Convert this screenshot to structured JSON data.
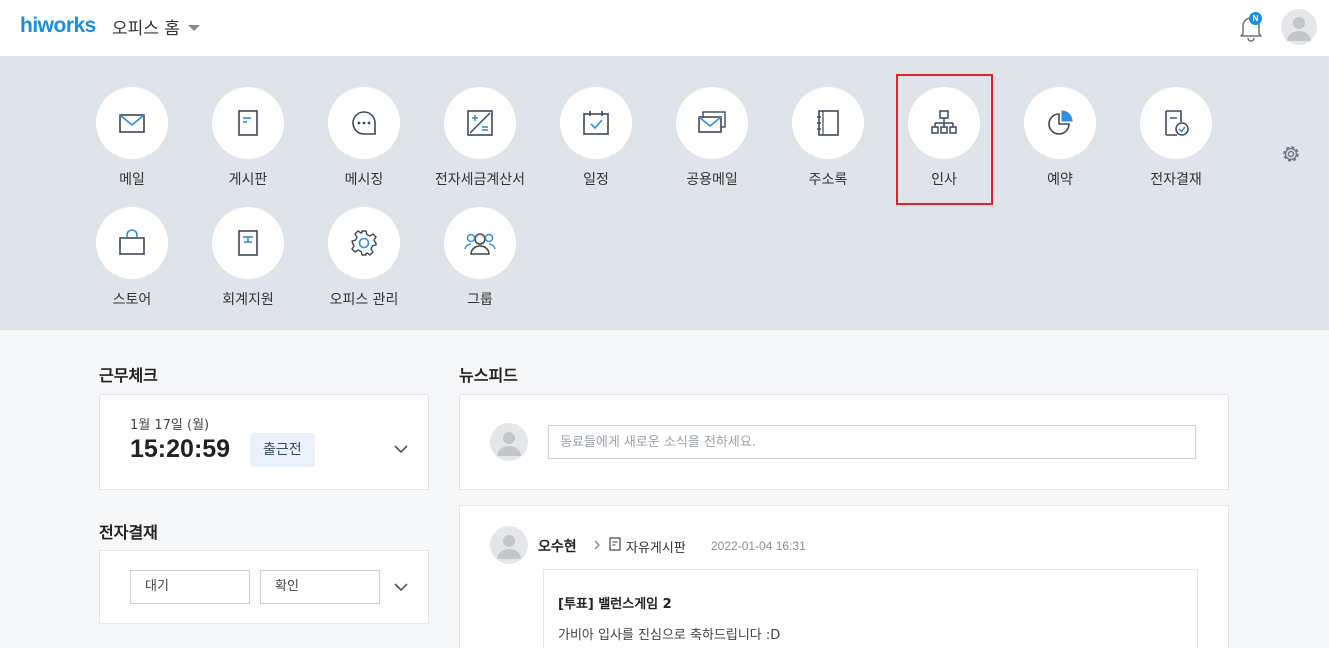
{
  "header": {
    "logo": "hiworks",
    "office_title": "오피스 홈",
    "notification_badge": "N"
  },
  "apps": [
    {
      "label": "메일",
      "icon": "mail-icon"
    },
    {
      "label": "게시판",
      "icon": "board-icon"
    },
    {
      "label": "메시징",
      "icon": "chat-bubble-icon"
    },
    {
      "label": "전자세금계산서",
      "icon": "tax-invoice-icon"
    },
    {
      "label": "일정",
      "icon": "calendar-icon"
    },
    {
      "label": "공용메일",
      "icon": "shared-mail-icon"
    },
    {
      "label": "주소록",
      "icon": "address-book-icon"
    },
    {
      "label": "인사",
      "icon": "org-chart-icon"
    },
    {
      "label": "예약",
      "icon": "pie-chart-icon"
    },
    {
      "label": "전자결재",
      "icon": "approval-document-icon"
    },
    {
      "label": "스토어",
      "icon": "shopping-bag-icon"
    },
    {
      "label": "회계지원",
      "icon": "ledger-icon"
    },
    {
      "label": "오피스 관리",
      "icon": "gear-icon"
    },
    {
      "label": "그룹",
      "icon": "group-users-icon"
    }
  ],
  "attendance": {
    "title": "근무체크",
    "date": "1월 17일 (월)",
    "time": "15:20:59",
    "status": "출근전"
  },
  "approval": {
    "title": "전자결재",
    "waiting_label": "대기",
    "confirm_label": "확인"
  },
  "newsfeed": {
    "title": "뉴스피드",
    "placeholder": "동료들에게 새로운 소식을 전하세요.",
    "post": {
      "author": "오수현",
      "board": "자유게시판",
      "date": "2022-01-04 16:31",
      "title": "[투표] 밸런스게임 2",
      "text": "가비아 입사를 진심으로 축하드립니다 :D"
    }
  },
  "colors": {
    "brand": "#1a8ee0",
    "panel_bg": "#dfe4ea",
    "highlight": "#e0242b",
    "icon_stroke": "#3d4a5a",
    "icon_accent": "#2f8fd8"
  }
}
